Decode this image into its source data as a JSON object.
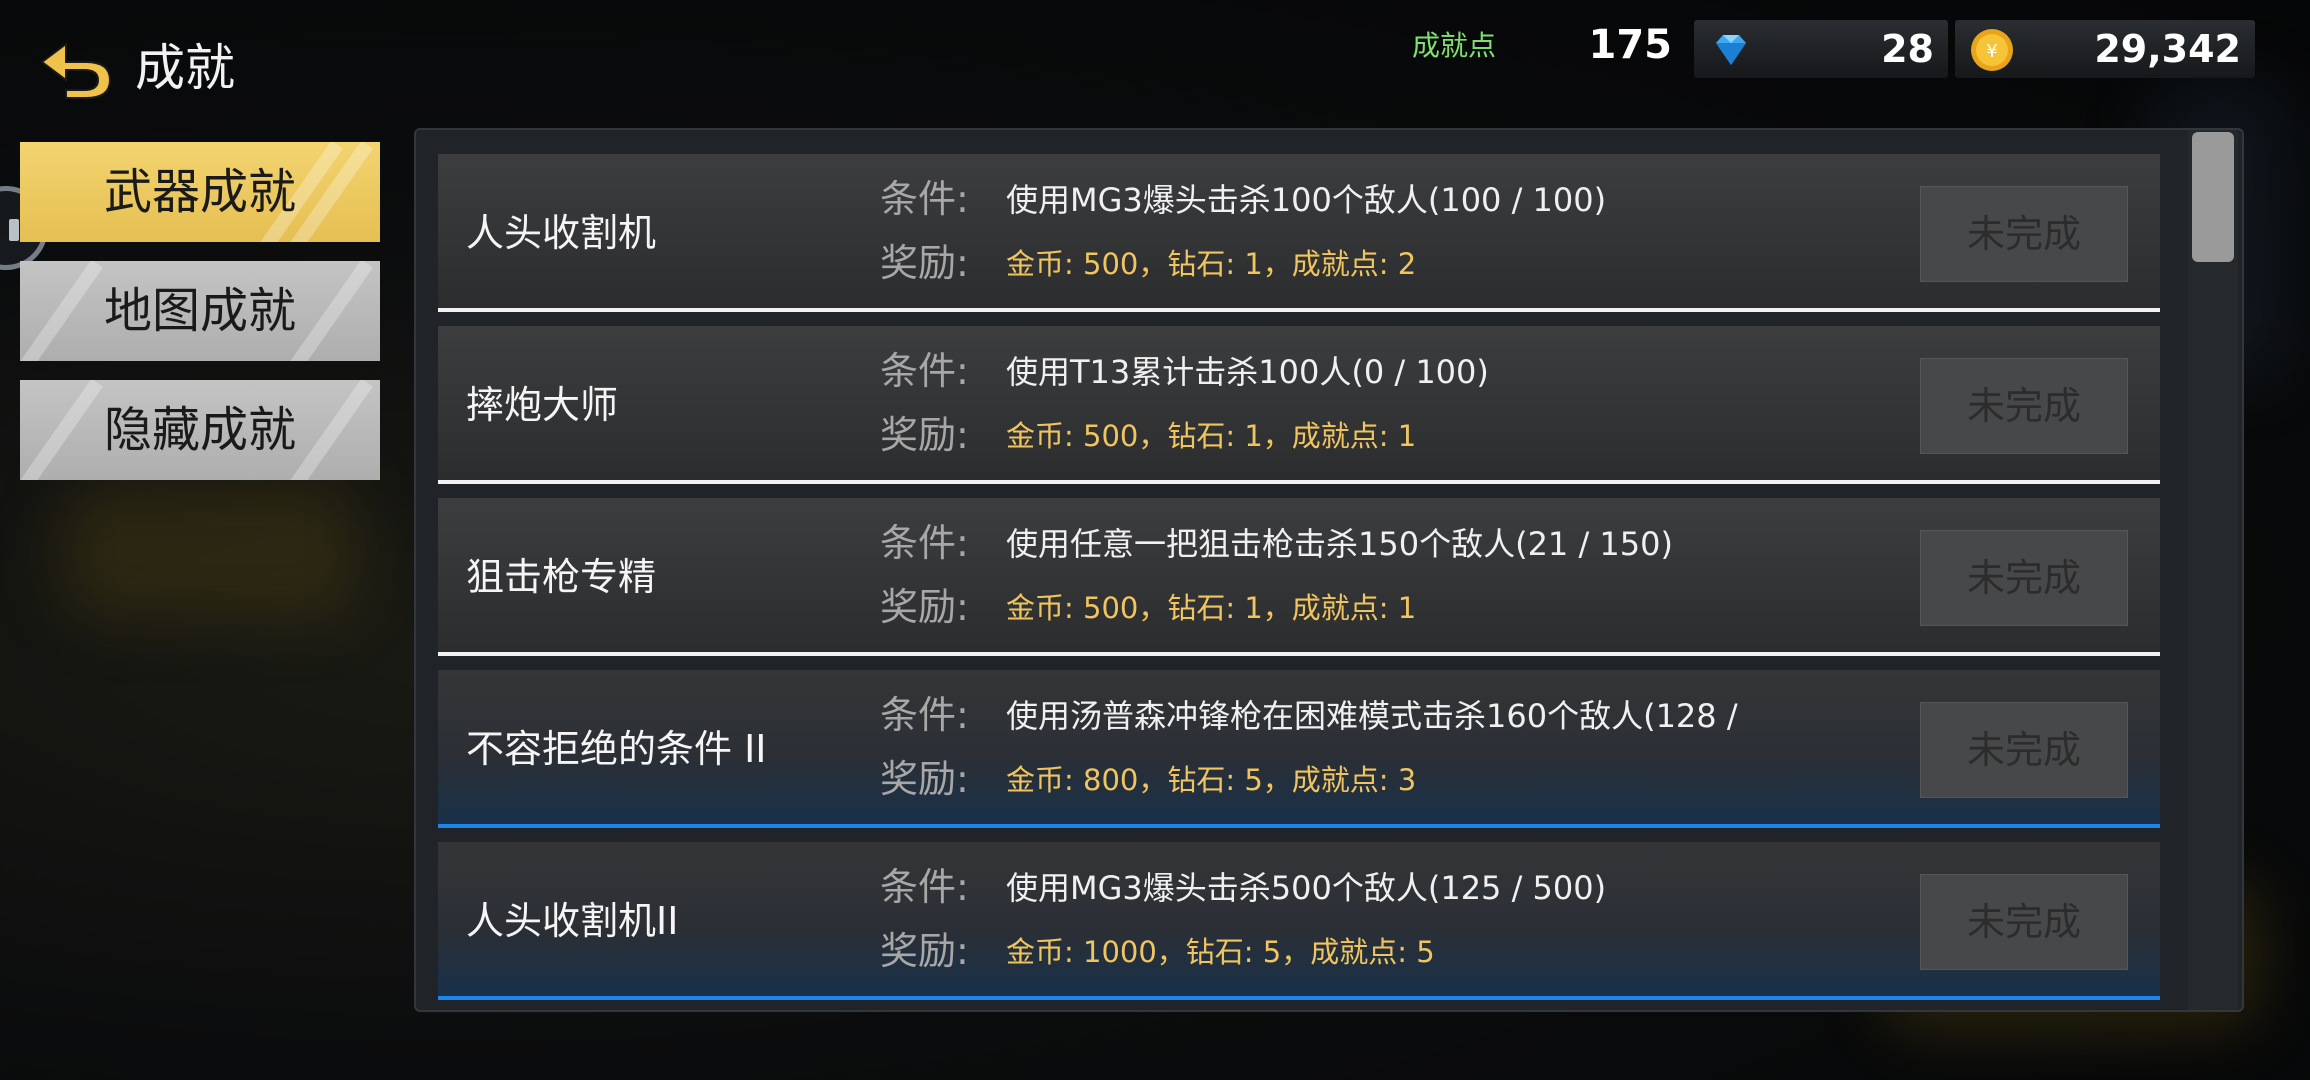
{
  "header": {
    "title": "成就",
    "achievement_label": "成就点",
    "achievement_points": "175",
    "gems": "28",
    "coins": "29,342"
  },
  "tabs": [
    {
      "label": "武器成就",
      "active": true
    },
    {
      "label": "地图成就",
      "active": false
    },
    {
      "label": "隐藏成就",
      "active": false
    }
  ],
  "labels": {
    "condition": "条件:",
    "reward": "奖励:"
  },
  "achievements": [
    {
      "name": "人头收割机",
      "condition": "使用MG3爆头击杀100个敌人(100 / 100)",
      "reward": "金币: 500，钻石: 1，成就点: 2",
      "status": "未完成"
    },
    {
      "name": "摔炮大师",
      "condition": "使用T13累计击杀100人(0 / 100)",
      "reward": "金币: 500，钻石: 1，成就点: 1",
      "status": "未完成"
    },
    {
      "name": "狙击枪专精",
      "condition": "使用任意一把狙击枪击杀150个敌人(21 / 150)",
      "reward": "金币: 500，钻石: 1，成就点: 1",
      "status": "未完成"
    },
    {
      "name": "不容拒绝的条件 II",
      "condition": "使用汤普森冲锋枪在困难模式击杀160个敌人(128 /",
      "reward": "金币: 800，钻石: 5，成就点: 3",
      "status": "未完成"
    },
    {
      "name": "人头收割机II",
      "condition": "使用MG3爆头击杀500个敌人(125 / 500)",
      "reward": "金币: 1000，钻石: 5，成就点: 5",
      "status": "未完成"
    }
  ],
  "colors": {
    "tab_active": "#e5bf52",
    "tab_inactive": "#b8b8b8",
    "reward_text": "#f0c560",
    "achievement_label": "#7fe06d",
    "row_separator_white": "#f2f2f2",
    "row_separator_blue": "#1c87ea"
  },
  "icons": [
    "back-arrow-icon",
    "diamond-icon",
    "coin-icon"
  ]
}
